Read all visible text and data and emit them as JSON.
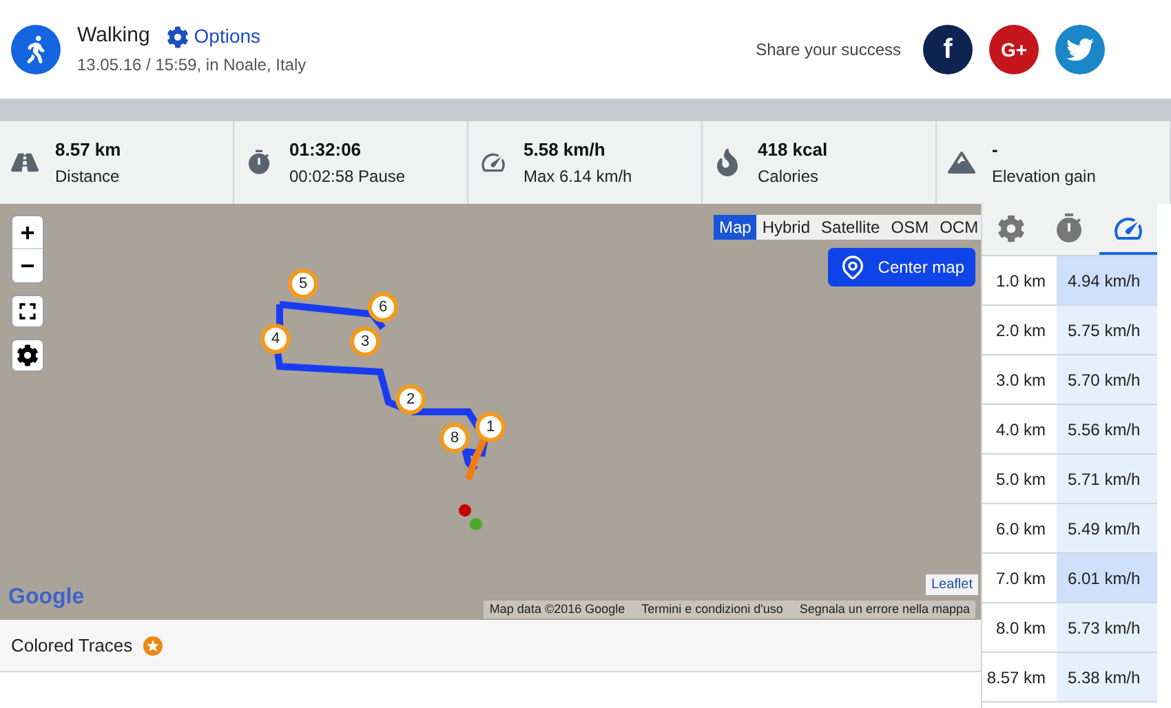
{
  "activity": {
    "title": "Walking",
    "options_label": "Options",
    "subtitle": "13.05.16 / 15:59, in Noale, Italy"
  },
  "share": {
    "label": "Share your success",
    "buttons": [
      {
        "kind": "facebook",
        "label": "f"
      },
      {
        "kind": "google",
        "label": "G+"
      },
      {
        "kind": "twitter"
      }
    ]
  },
  "stats": [
    {
      "kind": "road",
      "value": "8.57 km",
      "label": "Distance"
    },
    {
      "kind": "stopwatch",
      "value": "01:32:06",
      "label": "00:02:58 Pause"
    },
    {
      "kind": "speedometer",
      "value": "5.58 km/h",
      "label": "Max 6.14 km/h"
    },
    {
      "kind": "flame",
      "value": "418 kcal",
      "label": "Calories"
    },
    {
      "kind": "mountain",
      "value": "-",
      "label": "Elevation gain"
    }
  ],
  "map": {
    "zoom_in": "+",
    "zoom_out": "−",
    "layers": [
      {
        "label": "Map",
        "selected": true
      },
      {
        "label": "Hybrid",
        "selected": false
      },
      {
        "label": "Satellite",
        "selected": false
      },
      {
        "label": "OSM",
        "selected": false
      },
      {
        "label": "OCM",
        "selected": false
      }
    ],
    "center_button": "Center map",
    "markers": [
      "5",
      "6",
      "4",
      "3",
      "2",
      "8",
      "1"
    ],
    "leaflet": "Leaflet",
    "logo": "Google",
    "attribution": [
      "Map data ©2016 Google",
      "Termini e condizioni d'uso",
      "Segnala un errore nella mappa"
    ]
  },
  "panel_tabs": [
    {
      "kind": "settings",
      "selected": false
    },
    {
      "kind": "stopwatch",
      "selected": false
    },
    {
      "kind": "speedometer",
      "selected": true
    }
  ],
  "splits": [
    {
      "distance": "1.0 km",
      "speed": "4.94 km/h",
      "highlight": true
    },
    {
      "distance": "2.0 km",
      "speed": "5.75 km/h",
      "highlight": false
    },
    {
      "distance": "3.0 km",
      "speed": "5.70 km/h",
      "highlight": false
    },
    {
      "distance": "4.0 km",
      "speed": "5.56 km/h",
      "highlight": false
    },
    {
      "distance": "5.0 km",
      "speed": "5.71 km/h",
      "highlight": false
    },
    {
      "distance": "6.0 km",
      "speed": "5.49 km/h",
      "highlight": false
    },
    {
      "distance": "7.0 km",
      "speed": "6.01 km/h",
      "highlight": true
    },
    {
      "distance": "8.0 km",
      "speed": "5.73 km/h",
      "highlight": false
    },
    {
      "distance": "8.57 km",
      "speed": "5.38 km/h",
      "highlight": false
    }
  ],
  "colored_traces": {
    "label": "Colored Traces"
  }
}
